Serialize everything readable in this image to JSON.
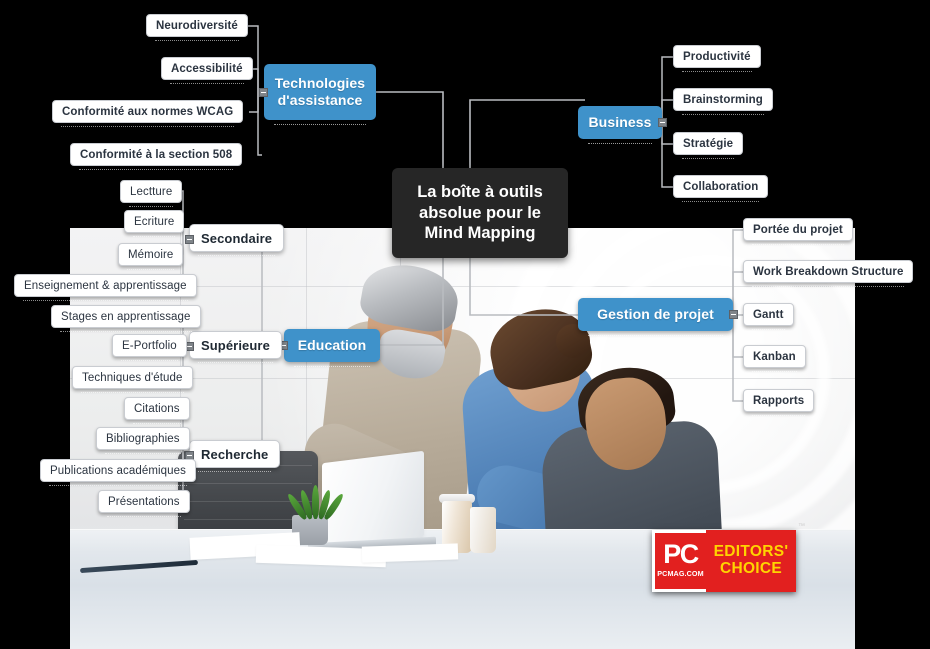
{
  "central": {
    "label": "La boîte à outils absolue pour le Mind Mapping"
  },
  "branches": {
    "assistive": {
      "label": "Technologies d'assistance",
      "label_line1": "Technologies",
      "label_line2": "d'assistance",
      "color": "#3f92ca",
      "children": [
        "Neurodiversité",
        "Accessibilité",
        "Conformité aux normes WCAG",
        "Conformité à la section 508"
      ]
    },
    "business": {
      "label": "Business",
      "color": "#3f92ca",
      "children": [
        "Productivité",
        "Brainstorming",
        "Stratégie",
        "Collaboration"
      ]
    },
    "education": {
      "label": "Education",
      "color": "#3f92ca",
      "groups": [
        {
          "label": "Secondaire",
          "children": [
            "Lectture",
            "Ecriture",
            "Mémoire",
            "Enseignement & apprentissage"
          ]
        },
        {
          "label": "Supérieure",
          "children": [
            "Stages en apprentissage",
            "E-Portfolio",
            "Techniques d'étude"
          ]
        },
        {
          "label": "Recherche",
          "children": [
            "Citations",
            "Bibliographies",
            "Publications académiques",
            "Présentations"
          ]
        }
      ]
    },
    "project": {
      "label": "Gestion de projet",
      "color": "#3f92ca",
      "children": [
        "Portée du projet",
        "Work Breakdown Structure",
        "Gantt",
        "Kanban",
        "Rapports"
      ]
    }
  },
  "badge": {
    "logo": "PC",
    "url": "PCMAG.COM",
    "line1": "EDITORS'",
    "line2": "CHOICE",
    "trademark": "™",
    "red": "#e2201f",
    "yellow": "#ffd400"
  }
}
